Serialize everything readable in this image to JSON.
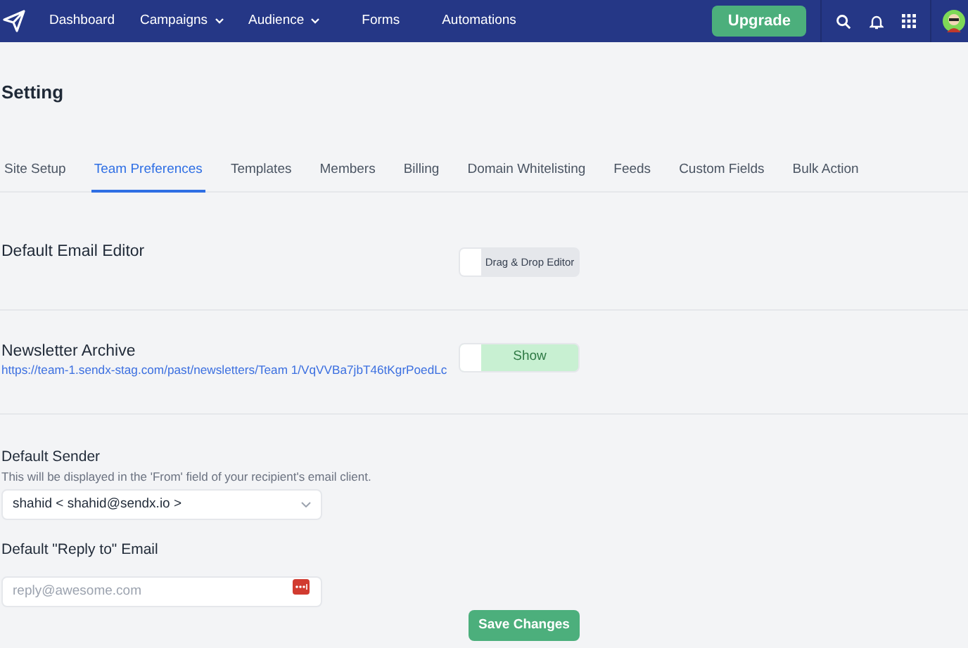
{
  "nav": {
    "items": [
      {
        "label": "Dashboard",
        "dropdown": false
      },
      {
        "label": "Campaigns",
        "dropdown": true
      },
      {
        "label": "Audience",
        "dropdown": true
      },
      {
        "label": "Forms",
        "dropdown": false
      },
      {
        "label": "Automations",
        "dropdown": false
      }
    ],
    "upgrade": "Upgrade"
  },
  "page_title": "Setting",
  "tabs": [
    {
      "label": "Site Setup",
      "selected": false
    },
    {
      "label": "Team Preferences",
      "selected": true
    },
    {
      "label": "Templates",
      "selected": false
    },
    {
      "label": "Members",
      "selected": false
    },
    {
      "label": "Billing",
      "selected": false
    },
    {
      "label": "Domain Whitelisting",
      "selected": false
    },
    {
      "label": "Feeds",
      "selected": false
    },
    {
      "label": "Custom Fields",
      "selected": false
    },
    {
      "label": "Bulk Action",
      "selected": false
    }
  ],
  "email_editor": {
    "label": "Default Email Editor",
    "toggle": {
      "label": "Drag & Drop Editor",
      "on": false
    }
  },
  "newsletter_archive": {
    "label": "Newsletter Archive",
    "link": "https://team-1.sendx-stag.com/past/newsletters/Team 1/VqVVBa7jbT46tKgrPoedLc",
    "toggle": {
      "label": "Show",
      "on": true
    }
  },
  "default_sender": {
    "label": "Default Sender",
    "hint": "This will be displayed in the 'From' field of your recipient's email client.",
    "value": "shahid < shahid@sendx.io >"
  },
  "reply_to": {
    "label": "Default \"Reply to\" Email",
    "placeholder": "reply@awesome.com"
  },
  "save_button": "Save Changes"
}
